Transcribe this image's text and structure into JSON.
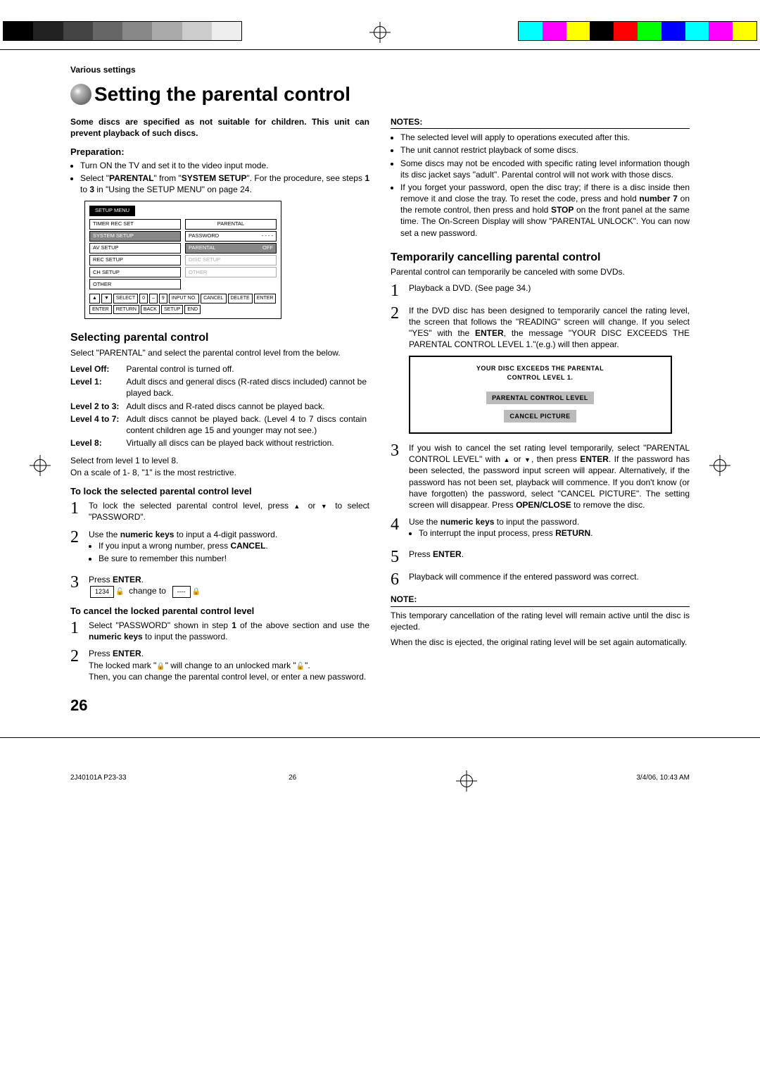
{
  "header": {
    "section_label": "Various settings"
  },
  "title": "Setting the parental control",
  "intro": "Some discs are specified as not suitable for children. This unit can prevent playback of such discs.",
  "prep": {
    "heading": "Preparation:",
    "items": [
      "Turn ON the TV and set it to the video input mode.",
      "Select \"PARENTAL\" from \"SYSTEM SETUP\". For the procedure, see steps 1 to 3 in \"Using the SETUP MENU\" on page 24."
    ]
  },
  "menu": {
    "tab": "SETUP MENU",
    "left": [
      "TIMER REC SET",
      "SYSTEM SETUP",
      "AV SETUP",
      "REC SETUP",
      "CH SETUP",
      "OTHER"
    ],
    "right_header": "PARENTAL",
    "right": [
      {
        "k": "PASSWORD",
        "v": "- - - -"
      },
      {
        "k": "PARENTAL",
        "v": "OFF",
        "hl": true
      },
      {
        "k": "DISC SETUP",
        "gray": true
      },
      {
        "k": "OTHER",
        "gray": true
      }
    ],
    "footer": [
      [
        "▲",
        "▼",
        "SELECT"
      ],
      [
        "0",
        "–",
        "9",
        "INPUT NO."
      ],
      [
        "CANCEL",
        "DELETE"
      ],
      [
        "ENTER",
        "ENTER"
      ],
      [
        "RETURN",
        "BACK"
      ],
      [
        "SETUP",
        "END"
      ]
    ]
  },
  "selecting": {
    "heading": "Selecting parental control",
    "intro": "Select \"PARENTAL\" and select the parental control level from the below.",
    "levels": [
      [
        "Level Off:",
        "Parental control is turned off."
      ],
      [
        "Level 1:",
        "Adult discs and general discs (R-rated discs included) cannot be played back."
      ],
      [
        "Level 2 to 3:",
        "Adult discs and R-rated discs cannot be played back."
      ],
      [
        "Level 4 to 7:",
        "Adult discs cannot be played back. (Level 4 to 7 discs contain content children age 15 and younger may not see.)"
      ],
      [
        "Level 8:",
        "Virtually all discs can be played back without restriction."
      ]
    ],
    "tail1": "Select from level 1 to level 8.",
    "tail2": "On a scale of 1- 8, \"1\" is the most restrictive."
  },
  "lock": {
    "heading": "To lock the selected parental control level",
    "steps": [
      "To lock the selected parental control level, press ▲ or ▼ to select \"PASSWORD\".",
      "Use the numeric keys to input a 4-digit password.\n• If you input a wrong number, press CANCEL.\n• Be sure to remember this number!",
      "Press ENTER."
    ],
    "change_label_before": "1234",
    "change_text": "change to",
    "change_label_after": "----"
  },
  "cancel_lock": {
    "heading": "To cancel the locked parental control level",
    "steps": [
      "Select \"PASSWORD\" shown in step 1 of the above section and use the numeric keys to input the password.",
      "Press ENTER.\nThe locked mark \"🔒\" will change to an unlocked mark \"🔓\".\nThen, you can change the parental control level, or enter a new password."
    ]
  },
  "notes": {
    "heading": "NOTES:",
    "items": [
      "The selected level will apply to operations executed after this.",
      "The unit cannot restrict playback of some discs.",
      "Some discs may not be encoded with specific rating level information though its disc jacket says \"adult\". Parental control will not work with those discs.",
      "If you forget your password, open the disc tray; if there is a disc inside then remove it and close the tray. To reset the code, press and hold number 7 on the remote control, then press and hold STOP on the front panel at the same time. The On-Screen Display will show \"PARENTAL UNLOCK\". You can now set a new password."
    ]
  },
  "temp": {
    "heading": "Temporarily cancelling parental control",
    "intro": "Parental control can temporarily be canceled with some DVDs.",
    "steps": [
      "Playback a DVD. (See page 34.)",
      "If the DVD disc has been designed to temporarily cancel the rating level, the screen that follows the \"READING\" screen will change. If you select \"YES\" with the ENTER, the message \"YOUR DISC EXCEEDS THE PARENTAL CONTROL LEVEL 1.\"(e.g.) will then appear.",
      "If you wish to cancel the set rating level temporarily, select \"PARENTAL CONTROL LEVEL\" with ▲ or ▼, then press ENTER. If the password has been selected, the password input screen will appear. Alternatively, if the password has not been set, playback will commence. If you don't know (or have forgotten) the password, select \"CANCEL PICTURE\". The setting screen will disappear. Press OPEN/CLOSE to remove the disc.",
      "Use the numeric keys to input the password.\n• To interrupt the input process, press RETURN.",
      "Press ENTER.",
      "Playback will commence if the entered password was correct."
    ],
    "screen": {
      "line1": "YOUR DISC EXCEEDS THE PARENTAL",
      "line2": "CONTROL LEVEL 1.",
      "opt1": "PARENTAL CONTROL LEVEL",
      "opt2": "CANCEL PICTURE"
    },
    "note_heading": "NOTE:",
    "note1": "This temporary cancellation of the rating level will remain active until the disc is ejected.",
    "note2": "When the disc is ejected, the original rating level will be set again automatically."
  },
  "page_number": "26",
  "footer": {
    "left": "2J40101A P23-33",
    "center": "26",
    "right": "3/4/06, 10:43 AM"
  }
}
